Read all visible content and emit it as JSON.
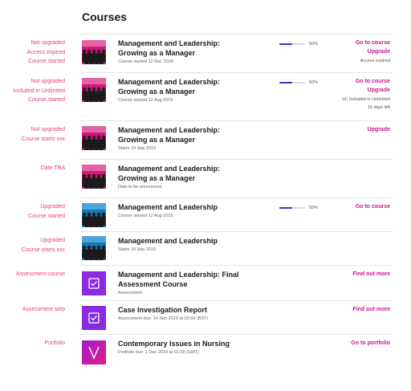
{
  "page_title": "Courses",
  "rows": [
    {
      "state": [
        "Not upgraded",
        "Access expired",
        "Course started"
      ],
      "title": [
        "Management and Leadership:",
        "Growing as a Manager"
      ],
      "subtitle": "Course started 12 Dec 2018",
      "thumb": "people-pink",
      "progress": 50,
      "progress_label": "50%",
      "actions": [
        "Go to course",
        "Upgrade"
      ],
      "meta": [
        "Access expired"
      ]
    },
    {
      "state": [
        "Not upgraded",
        "Included in Unlimited",
        "Course started"
      ],
      "title": [
        "Management and Leadership:",
        "Growing as a Manager"
      ],
      "subtitle": "Course started 12 Aug 2019",
      "thumb": "people-pink",
      "progress": 50,
      "progress_label": "50%",
      "actions": [
        "Go to course",
        "Upgrade"
      ],
      "meta": [
        "oC Included in Unlimited",
        "15 days left"
      ]
    },
    {
      "state": [
        "Not upgraded",
        "Course starts xxx"
      ],
      "title": [
        "Management and Leadership:",
        "Growing as a Manager"
      ],
      "subtitle": "Starts 19 Sep 2019",
      "thumb": "people-pink",
      "actions": [
        "Upgrade"
      ]
    },
    {
      "state": [
        "Date TBA"
      ],
      "title": [
        "Management and Leadership:",
        "Growing as a Manager"
      ],
      "subtitle": "Date to be announced",
      "thumb": "people-pink"
    },
    {
      "state": [
        "Upgraded",
        "Course started"
      ],
      "title": [
        "Management and Leadership"
      ],
      "subtitle": "Course started 12 Aug 2019",
      "thumb": "people-blue",
      "progress": 50,
      "progress_label": "50%",
      "actions": [
        "Go to course"
      ]
    },
    {
      "state": [
        "Upgraded",
        "Course starts xxx"
      ],
      "title": [
        "Management and Leadership"
      ],
      "subtitle": "Starts 19 Sep 2019",
      "thumb": "people-blue"
    },
    {
      "state": [
        "Assessment course"
      ],
      "title": [
        "Management and Leadership: Final",
        "Assessment Course"
      ],
      "subtitle": "Assessment",
      "thumb": "check-purple",
      "actions": [
        "Find out more"
      ]
    },
    {
      "state": [
        "Assessment step"
      ],
      "title": [
        "Case Investigation Report"
      ],
      "subtitle": "Assessment due: 14 Sep 2019 at 00:59 (BST)",
      "thumb": "check-purple",
      "actions": [
        "Find out more"
      ]
    },
    {
      "state": [
        "Portfolio"
      ],
      "title": [
        "Contemporary Issues in Nursing"
      ],
      "subtitle": "Portfolio due: 1 Dec 2019 at 01:59 (GMT)",
      "thumb": "v-purple",
      "actions": [
        "Go to portfolio"
      ]
    }
  ],
  "colors": {
    "accent": "#c8148f",
    "state_label": "#e8436e",
    "progress": "#3b2fd6",
    "thumb_pink": "#d4177a",
    "thumb_blue": "#1479b8",
    "thumb_purple": "#8a2be2"
  }
}
